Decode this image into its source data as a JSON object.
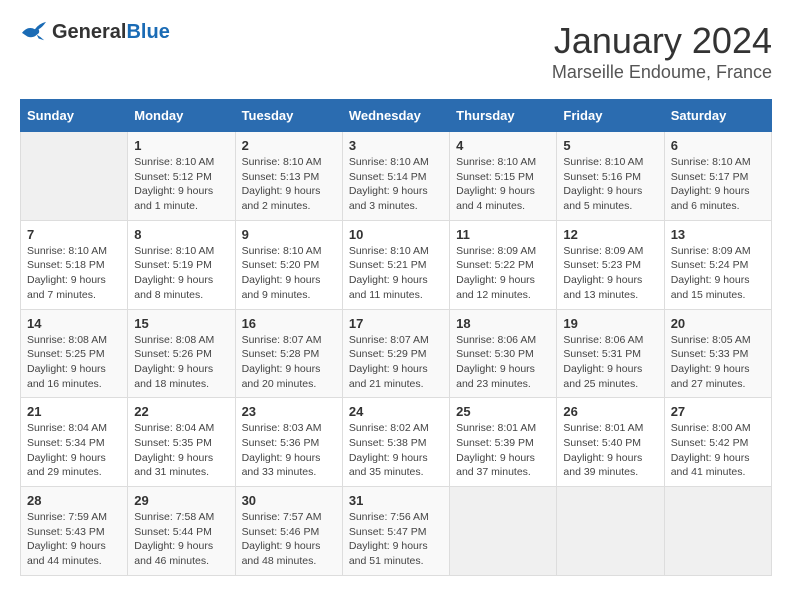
{
  "header": {
    "logo_general": "General",
    "logo_blue": "Blue",
    "month": "January 2024",
    "location": "Marseille Endoume, France"
  },
  "weekdays": [
    "Sunday",
    "Monday",
    "Tuesday",
    "Wednesday",
    "Thursday",
    "Friday",
    "Saturday"
  ],
  "weeks": [
    [
      {
        "day": "",
        "info": ""
      },
      {
        "day": "1",
        "info": "Sunrise: 8:10 AM\nSunset: 5:12 PM\nDaylight: 9 hours\nand 1 minute."
      },
      {
        "day": "2",
        "info": "Sunrise: 8:10 AM\nSunset: 5:13 PM\nDaylight: 9 hours\nand 2 minutes."
      },
      {
        "day": "3",
        "info": "Sunrise: 8:10 AM\nSunset: 5:14 PM\nDaylight: 9 hours\nand 3 minutes."
      },
      {
        "day": "4",
        "info": "Sunrise: 8:10 AM\nSunset: 5:15 PM\nDaylight: 9 hours\nand 4 minutes."
      },
      {
        "day": "5",
        "info": "Sunrise: 8:10 AM\nSunset: 5:16 PM\nDaylight: 9 hours\nand 5 minutes."
      },
      {
        "day": "6",
        "info": "Sunrise: 8:10 AM\nSunset: 5:17 PM\nDaylight: 9 hours\nand 6 minutes."
      }
    ],
    [
      {
        "day": "7",
        "info": "Sunrise: 8:10 AM\nSunset: 5:18 PM\nDaylight: 9 hours\nand 7 minutes."
      },
      {
        "day": "8",
        "info": "Sunrise: 8:10 AM\nSunset: 5:19 PM\nDaylight: 9 hours\nand 8 minutes."
      },
      {
        "day": "9",
        "info": "Sunrise: 8:10 AM\nSunset: 5:20 PM\nDaylight: 9 hours\nand 9 minutes."
      },
      {
        "day": "10",
        "info": "Sunrise: 8:10 AM\nSunset: 5:21 PM\nDaylight: 9 hours\nand 11 minutes."
      },
      {
        "day": "11",
        "info": "Sunrise: 8:09 AM\nSunset: 5:22 PM\nDaylight: 9 hours\nand 12 minutes."
      },
      {
        "day": "12",
        "info": "Sunrise: 8:09 AM\nSunset: 5:23 PM\nDaylight: 9 hours\nand 13 minutes."
      },
      {
        "day": "13",
        "info": "Sunrise: 8:09 AM\nSunset: 5:24 PM\nDaylight: 9 hours\nand 15 minutes."
      }
    ],
    [
      {
        "day": "14",
        "info": "Sunrise: 8:08 AM\nSunset: 5:25 PM\nDaylight: 9 hours\nand 16 minutes."
      },
      {
        "day": "15",
        "info": "Sunrise: 8:08 AM\nSunset: 5:26 PM\nDaylight: 9 hours\nand 18 minutes."
      },
      {
        "day": "16",
        "info": "Sunrise: 8:07 AM\nSunset: 5:28 PM\nDaylight: 9 hours\nand 20 minutes."
      },
      {
        "day": "17",
        "info": "Sunrise: 8:07 AM\nSunset: 5:29 PM\nDaylight: 9 hours\nand 21 minutes."
      },
      {
        "day": "18",
        "info": "Sunrise: 8:06 AM\nSunset: 5:30 PM\nDaylight: 9 hours\nand 23 minutes."
      },
      {
        "day": "19",
        "info": "Sunrise: 8:06 AM\nSunset: 5:31 PM\nDaylight: 9 hours\nand 25 minutes."
      },
      {
        "day": "20",
        "info": "Sunrise: 8:05 AM\nSunset: 5:33 PM\nDaylight: 9 hours\nand 27 minutes."
      }
    ],
    [
      {
        "day": "21",
        "info": "Sunrise: 8:04 AM\nSunset: 5:34 PM\nDaylight: 9 hours\nand 29 minutes."
      },
      {
        "day": "22",
        "info": "Sunrise: 8:04 AM\nSunset: 5:35 PM\nDaylight: 9 hours\nand 31 minutes."
      },
      {
        "day": "23",
        "info": "Sunrise: 8:03 AM\nSunset: 5:36 PM\nDaylight: 9 hours\nand 33 minutes."
      },
      {
        "day": "24",
        "info": "Sunrise: 8:02 AM\nSunset: 5:38 PM\nDaylight: 9 hours\nand 35 minutes."
      },
      {
        "day": "25",
        "info": "Sunrise: 8:01 AM\nSunset: 5:39 PM\nDaylight: 9 hours\nand 37 minutes."
      },
      {
        "day": "26",
        "info": "Sunrise: 8:01 AM\nSunset: 5:40 PM\nDaylight: 9 hours\nand 39 minutes."
      },
      {
        "day": "27",
        "info": "Sunrise: 8:00 AM\nSunset: 5:42 PM\nDaylight: 9 hours\nand 41 minutes."
      }
    ],
    [
      {
        "day": "28",
        "info": "Sunrise: 7:59 AM\nSunset: 5:43 PM\nDaylight: 9 hours\nand 44 minutes."
      },
      {
        "day": "29",
        "info": "Sunrise: 7:58 AM\nSunset: 5:44 PM\nDaylight: 9 hours\nand 46 minutes."
      },
      {
        "day": "30",
        "info": "Sunrise: 7:57 AM\nSunset: 5:46 PM\nDaylight: 9 hours\nand 48 minutes."
      },
      {
        "day": "31",
        "info": "Sunrise: 7:56 AM\nSunset: 5:47 PM\nDaylight: 9 hours\nand 51 minutes."
      },
      {
        "day": "",
        "info": ""
      },
      {
        "day": "",
        "info": ""
      },
      {
        "day": "",
        "info": ""
      }
    ]
  ]
}
